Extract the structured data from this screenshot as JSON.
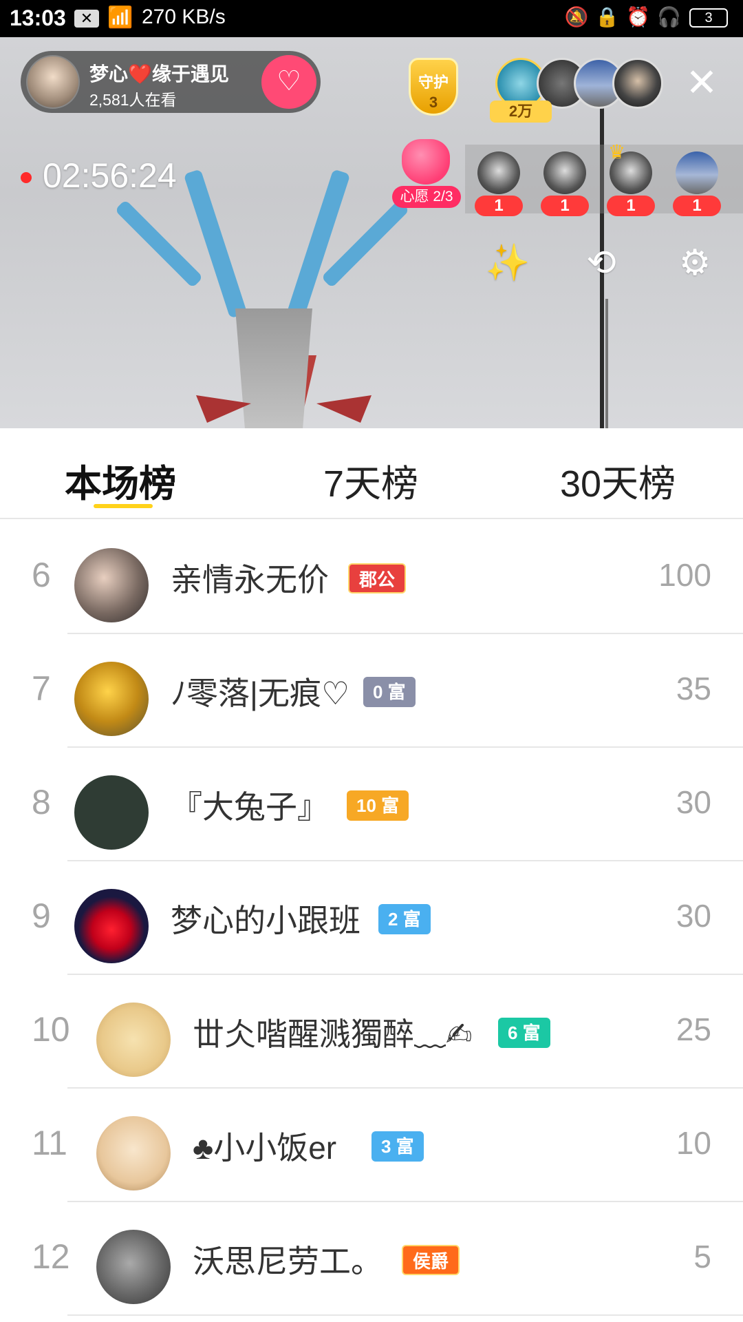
{
  "status_bar": {
    "time": "13:03",
    "speed": "270 KB/s",
    "battery": "3"
  },
  "live": {
    "host_name": "梦心❤️缘于遇见",
    "viewers": "2,581人在看",
    "guard_label": "守护",
    "guard_count": "3",
    "top_contribution": "2万",
    "timer": "02:56:24",
    "wish_label": "心愿 2/3",
    "gift_counts": [
      "1",
      "1",
      "1",
      "1"
    ]
  },
  "tabs": {
    "current": "本场榜",
    "seven_day": "7天榜",
    "thirty_day": "30天榜"
  },
  "rankings": [
    {
      "rank": "6",
      "name": "亲情永无价",
      "badge": "郡公",
      "badge_color": "#e8403e",
      "score": "100"
    },
    {
      "rank": "7",
      "name": "ﾉ零落|无痕♡",
      "badge": "0 富",
      "badge_color": "#8a8fa8",
      "score": "35"
    },
    {
      "rank": "8",
      "name": "『大兔子』",
      "badge": "10 富",
      "badge_color": "#f7a825",
      "score": "30"
    },
    {
      "rank": "9",
      "name": "梦心的小跟班",
      "badge": "2 富",
      "badge_color": "#4ab0f0",
      "score": "30"
    },
    {
      "rank": "10",
      "name": "丗仌喈醒溅獨醉﹏✍",
      "badge": "6 富",
      "badge_color": "#1bc8a4",
      "score": "25"
    },
    {
      "rank": "11",
      "name": "♣小小饭er",
      "badge": "3 富",
      "badge_color": "#4ab0f0",
      "score": "10"
    },
    {
      "rank": "12",
      "name": "沃思尼劳工。",
      "badge": "侯爵",
      "badge_color": "#ff6a1a",
      "score": "5"
    }
  ],
  "colors": {
    "accent": "#ffd21a",
    "follow": "#ff4a75",
    "live_dot": "#ff2a2a",
    "gift_count": "#ff3a3a"
  },
  "icons": [
    "x-icon",
    "wifi-icon",
    "mute-icon",
    "lock-icon",
    "alarm-icon",
    "headphones-icon",
    "battery-icon",
    "follow-heart-icon",
    "close-icon",
    "magic-wand-icon",
    "flip-camera-icon",
    "settings-icon",
    "crown-icon"
  ]
}
